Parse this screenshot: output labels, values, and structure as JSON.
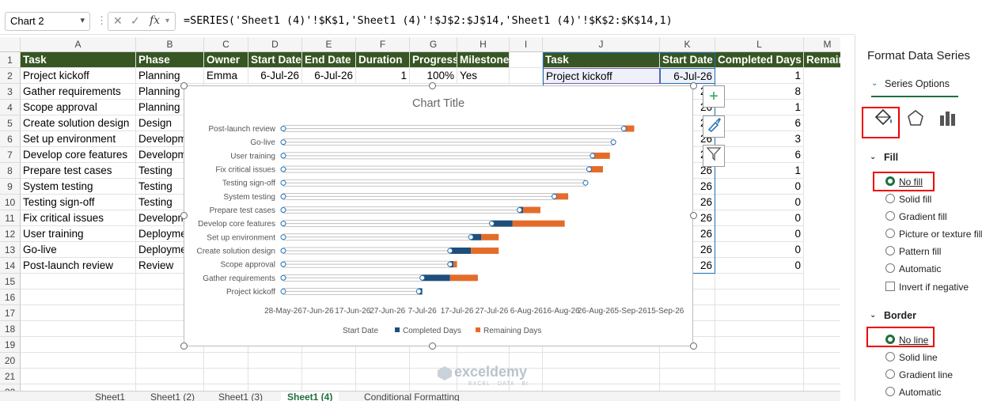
{
  "formula_bar": {
    "name_box": "Chart 2",
    "fx_label": "fx",
    "formula": "=SERIES('Sheet1 (4)'!$K$1,'Sheet1 (4)'!$J$2:$J$14,'Sheet1 (4)'!$K$2:$K$14,1)"
  },
  "columns": [
    "A",
    "B",
    "C",
    "D",
    "E",
    "F",
    "G",
    "H",
    "I",
    "J",
    "K",
    "L",
    "M"
  ],
  "rows": [
    "1",
    "2",
    "3",
    "4",
    "5",
    "6",
    "7",
    "8",
    "9",
    "10",
    "11",
    "12",
    "13",
    "14",
    "15",
    "16",
    "17",
    "18",
    "19",
    "20",
    "21",
    "22"
  ],
  "table_headers": [
    "Task",
    "Phase",
    "Owner",
    "Start Date",
    "End Date",
    "Duration",
    "Progress",
    "Milestone"
  ],
  "table_row2": [
    "Project kickoff",
    "Planning",
    "Emma",
    "6-Jul-26",
    "6-Jul-26",
    "1",
    "100%",
    "Yes"
  ],
  "col_a_tasks": [
    "Gather requirements",
    "Scope approval",
    "Create solution design",
    "Set up environment",
    "Develop core features",
    "Prepare test cases",
    "System testing",
    "Testing sign-off",
    "Fix critical issues",
    "User training",
    "Go-live",
    "Post-launch review"
  ],
  "col_b_phases": [
    "Planning",
    "Planning",
    "Design",
    "Developm",
    "Developm",
    "Testing",
    "Testing",
    "Testing",
    "Developm",
    "Deployme",
    "Deployme",
    "Review"
  ],
  "right_headers": [
    "Task",
    "Start Date",
    "Completed Days",
    "Remaini"
  ],
  "right_row2": [
    "Project kickoff",
    "6-Jul-26"
  ],
  "col_k_partial": [
    "26",
    "26",
    "26",
    "26",
    "26",
    "26",
    "26",
    "26",
    "26",
    "26",
    "26",
    "26"
  ],
  "completed_days_col": [
    "1",
    "8",
    "1",
    "6",
    "3",
    "6",
    "1",
    "0",
    "0",
    "0",
    "0",
    "0",
    "0"
  ],
  "chart": {
    "title": "Chart Title",
    "legend": [
      "Start Date",
      "Completed Days",
      "Remaining Days"
    ]
  },
  "chart_data": {
    "type": "bar",
    "orientation": "horizontal-stacked",
    "categories": [
      "Project kickoff",
      "Gather requirements",
      "Scope approval",
      "Create solution design",
      "Set up environment",
      "Develop core features",
      "Prepare test cases",
      "System testing",
      "Testing sign-off",
      "Fix critical issues",
      "User training",
      "Go-live",
      "Post-launch review"
    ],
    "x_tick_labels": [
      "28-May-26",
      "7-Jun-26",
      "17-Jun-26",
      "27-Jun-26",
      "7-Jul-26",
      "17-Jul-26",
      "27-Jul-26",
      "6-Aug-26",
      "16-Aug-26",
      "26-Aug-26",
      "5-Sep-26",
      "15-Sep-26"
    ],
    "xlim": [
      "28-May-26",
      "15-Sep-26"
    ],
    "series": [
      {
        "name": "Start Date",
        "color": "none",
        "values": [
          "6-Jul-26",
          "7-Jul-26",
          "15-Jul-26",
          "15-Jul-26",
          "21-Jul-26",
          "27-Jul-26",
          "4-Aug-26",
          "14-Aug-26",
          "23-Aug-26",
          "24-Aug-26",
          "25-Aug-26",
          "31-Aug-26",
          "3-Sep-26"
        ]
      },
      {
        "name": "Completed Days",
        "color": "#1f4e79",
        "values": [
          1,
          8,
          1,
          6,
          3,
          6,
          1,
          0,
          0,
          0,
          0,
          0,
          0
        ]
      },
      {
        "name": "Remaining Days",
        "color": "#e46c2a",
        "values": [
          0,
          8,
          1,
          8,
          5,
          15,
          5,
          4,
          0,
          4,
          5,
          0,
          3
        ]
      }
    ]
  },
  "panel": {
    "title": "Format Data Series",
    "series_options": "Series Options",
    "fill_header": "Fill",
    "fill_options": [
      "No fill",
      "Solid fill",
      "Gradient fill",
      "Picture or texture fill",
      "Pattern fill",
      "Automatic"
    ],
    "invert": "Invert if negative",
    "border_header": "Border",
    "border_options": [
      "No line",
      "Solid line",
      "Gradient line",
      "Automatic"
    ]
  },
  "sheet_tabs": [
    "Sheet1",
    "Sheet1 (2)",
    "Sheet1 (3)",
    "Sheet1 (4)",
    "Conditional Formatting"
  ],
  "watermark": "exceldemy",
  "watermark_sub": "EXCEL · DATA · BI"
}
